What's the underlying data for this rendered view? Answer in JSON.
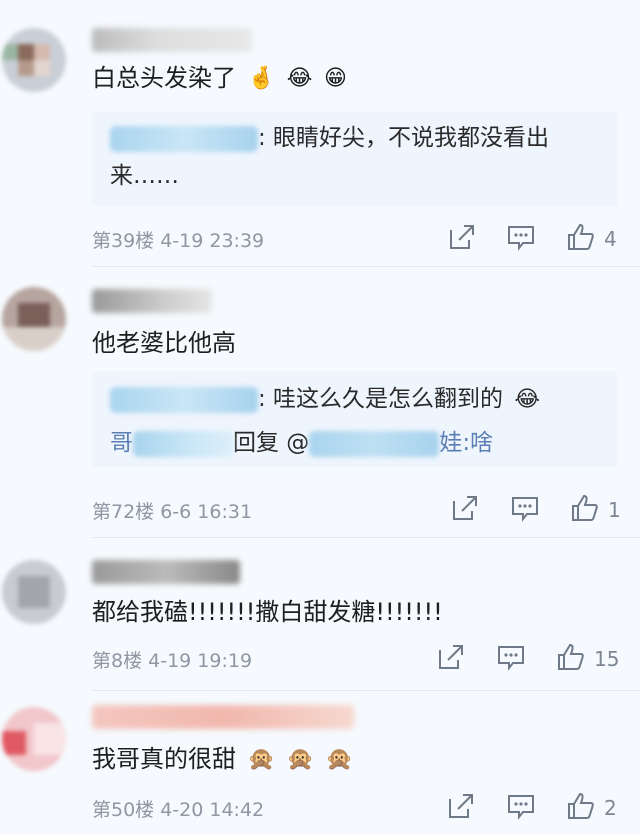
{
  "comments": [
    {
      "text": "白总头发染了",
      "emojis": [
        "🤞",
        "😂",
        "😁"
      ],
      "reply_text": ": 眼睛好尖，不说我都没看出",
      "reply_text2": "来……",
      "floor_time": "第39楼 4-19 23:39",
      "likes": "4"
    },
    {
      "text": "他老婆比他高",
      "reply_text": ": 哇这么久是怎么翻到的",
      "reply_emoji": "😂",
      "reply2_prefix": "哥",
      "reply2_mid": "回复 @",
      "reply2_end": "娃:啥",
      "floor_time": "第72楼 6-6 16:31",
      "likes": "1"
    },
    {
      "text": "都给我磕!!!!!!!撒白甜发糖!!!!!!!",
      "floor_time": "第8楼 4-19 19:19",
      "likes": "15"
    },
    {
      "text": "我哥真的很甜",
      "emojis": [
        "🙊",
        "🙊",
        "🙊"
      ],
      "floor_time": "第50楼 4-20 14:42",
      "likes": "2"
    }
  ],
  "icons": {
    "share": "share-icon",
    "comment": "comment-icon",
    "like": "thumbs-up-icon"
  },
  "colors": {
    "meta": "#8e97a3",
    "link": "#5b7fb4",
    "reply_bg": "#eef5fd",
    "icon": "#6f7a88"
  }
}
